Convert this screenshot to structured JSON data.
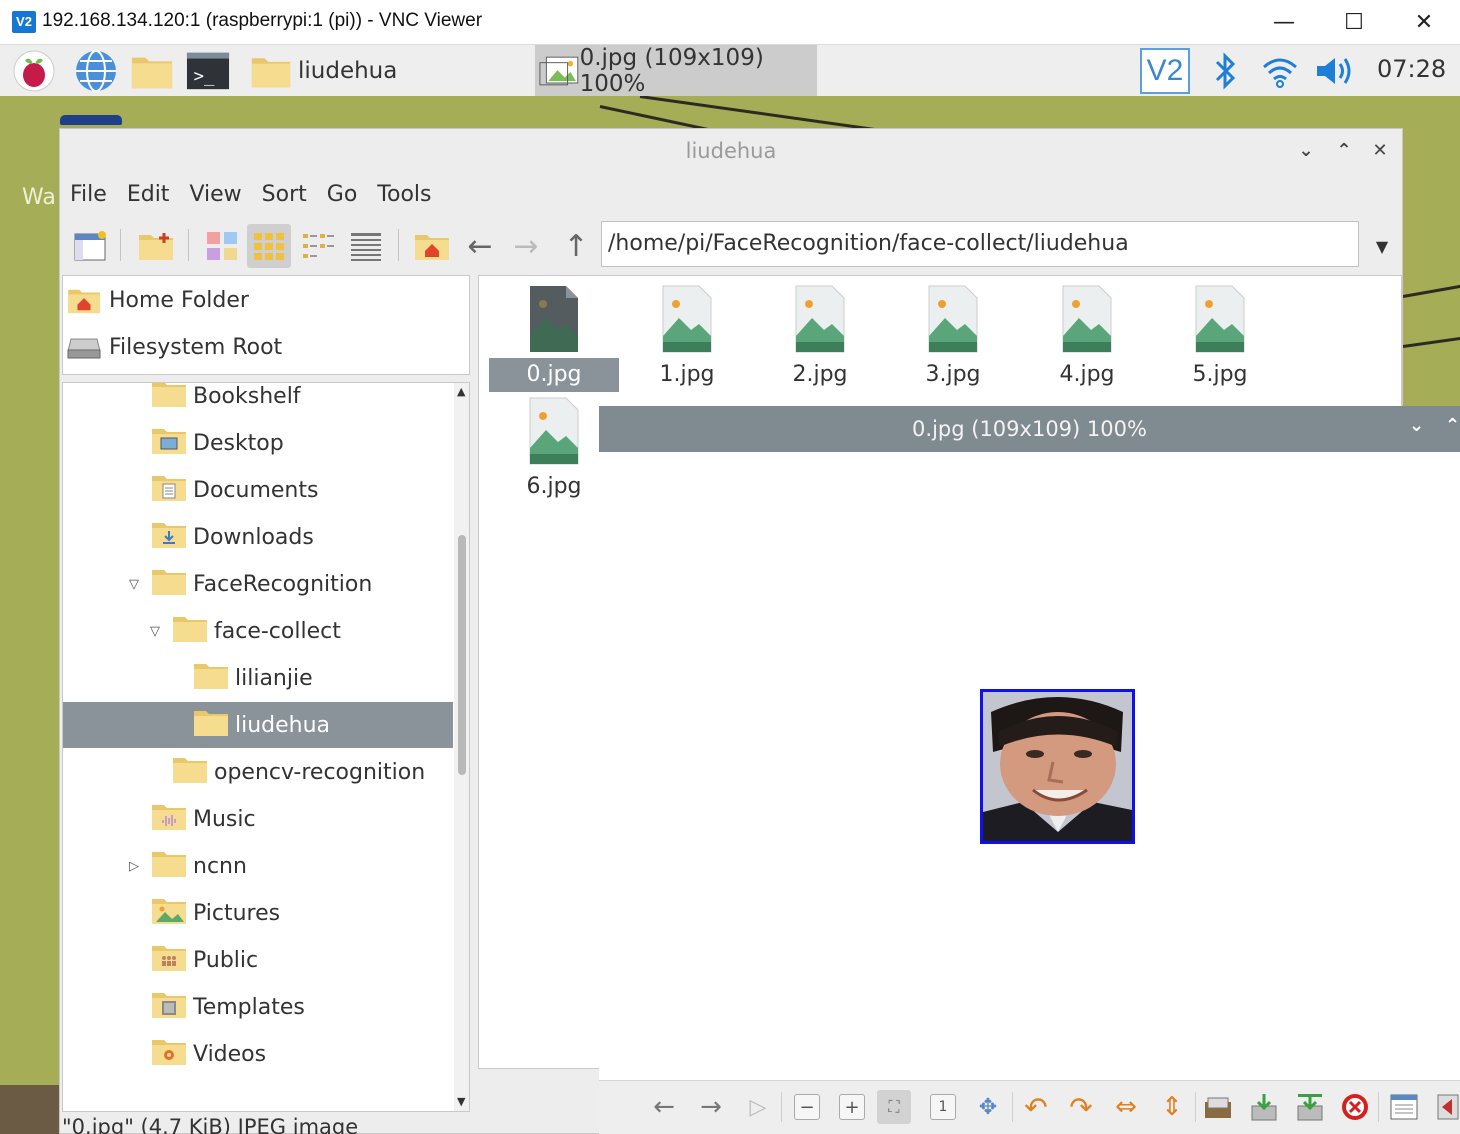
{
  "vnc": {
    "logo": "V2",
    "title": "192.168.134.120:1 (raspberrypi:1 (pi)) - VNC Viewer",
    "minimize": "—",
    "maximize": "☐",
    "close": "✕"
  },
  "taskbar": {
    "tasks": [
      "liudehua",
      "0.jpg (109x109) 100%"
    ],
    "vnc_badge": "V2",
    "clock": "07:28"
  },
  "desktop": {
    "partial_label": "Wa"
  },
  "file_manager": {
    "title": "liudehua",
    "menu": [
      "File",
      "Edit",
      "View",
      "Sort",
      "Go",
      "Tools"
    ],
    "path": "/home/pi/FaceRecognition/face-collect/liudehua",
    "places": [
      "Home Folder",
      "Filesystem Root"
    ],
    "tree": [
      {
        "label": "Bookshelf",
        "icon": "folder"
      },
      {
        "label": "Desktop",
        "icon": "desktop-folder"
      },
      {
        "label": "Documents",
        "icon": "documents-folder"
      },
      {
        "label": "Downloads",
        "icon": "downloads-folder"
      },
      {
        "label": "FaceRecognition",
        "icon": "folder",
        "expanded": true
      },
      {
        "label": "face-collect",
        "icon": "folder",
        "expanded": true
      },
      {
        "label": "lilianjie",
        "icon": "folder"
      },
      {
        "label": "liudehua",
        "icon": "folder",
        "selected": true
      },
      {
        "label": "opencv-recognition",
        "icon": "folder"
      },
      {
        "label": "Music",
        "icon": "music-folder"
      },
      {
        "label": "ncnn",
        "icon": "folder",
        "collapsed": true
      },
      {
        "label": "Pictures",
        "icon": "pictures-folder"
      },
      {
        "label": "Public",
        "icon": "public-folder"
      },
      {
        "label": "Templates",
        "icon": "templates-folder"
      },
      {
        "label": "Videos",
        "icon": "videos-folder"
      }
    ],
    "files": [
      "0.jpg",
      "1.jpg",
      "2.jpg",
      "3.jpg",
      "4.jpg",
      "5.jpg",
      "6.jpg"
    ],
    "selected_file": "0.jpg",
    "status": "\"0.jpg\" (4.7 KiB) JPEG image"
  },
  "viewer": {
    "title": "0.jpg (109x109) 100%"
  },
  "colors": {
    "selection": "#8a9399",
    "viewer_title": "#808a91",
    "desktop": "#a5ae57",
    "image_border": "#1010e8"
  }
}
